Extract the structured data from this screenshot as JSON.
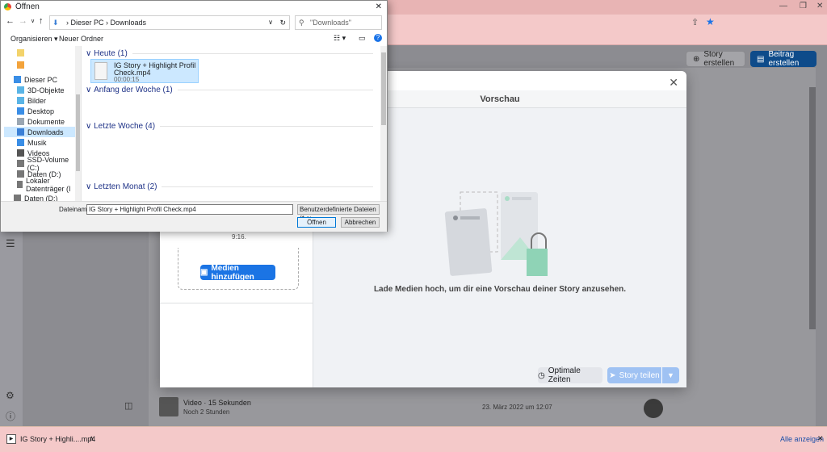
{
  "browser": {
    "bookmark_hint": ""
  },
  "page": {
    "story_button": "Story erstellen",
    "post_button": "Beitrag erstellen",
    "row_title": "Video · 15 Sekunden",
    "row_sub": "Noch 2 Stunden",
    "row_date": "23. März 2022 um 12:07"
  },
  "modal": {
    "preview_title": "Vorschau",
    "ratio_text": "9:16.",
    "add_media": "Medien hinzufügen",
    "empty_text": "Lade Medien hoch, um dir eine Vorschau deiner Story anzusehen.",
    "optimal_times": "Optimale Zeiten",
    "share_story": "Story teilen"
  },
  "dialog": {
    "title": "Öffnen",
    "path_pc": "Dieser PC",
    "path_folder": "Downloads",
    "search_placeholder": "\"Downloads\" durchsuchen",
    "organize": "Organisieren ▾",
    "new_folder": "Neuer Ordner",
    "tree": [
      {
        "label": "",
        "color": "#f3d36b"
      },
      {
        "label": "",
        "color": "#f3a33b"
      },
      {
        "label": "Dieser PC",
        "color": "#3a8ee6"
      },
      {
        "label": "3D-Objekte",
        "color": "#5ab4e6"
      },
      {
        "label": "Bilder",
        "color": "#5ab4e6"
      },
      {
        "label": "Desktop",
        "color": "#3a8ee6"
      },
      {
        "label": "Dokumente",
        "color": "#9aa6b2"
      },
      {
        "label": "Downloads",
        "color": "#3a7fd6"
      },
      {
        "label": "Musik",
        "color": "#3a8ee6"
      },
      {
        "label": "Videos",
        "color": "#555"
      },
      {
        "label": "SSD-Volume (C:)",
        "color": "#777"
      },
      {
        "label": "Daten (D:)",
        "color": "#777"
      },
      {
        "label": "Lokaler Datenträger (I",
        "color": "#777"
      },
      {
        "label": "Daten (D:)",
        "color": "#777"
      }
    ],
    "groups": {
      "today": "Heute (1)",
      "week": "Anfang der Woche (1)",
      "last_week": "Letzte Woche (4)",
      "last_month": "Letzten Monat (2)"
    },
    "file": {
      "name_line1": "IG Story + Highlight Profil",
      "name_line2": "Check.mp4",
      "duration": "00:00:15"
    },
    "filename_label": "Dateiname:",
    "filename_value": "IG Story + Highlight Profil Check.mp4",
    "filetype": "Benutzerdefinierte Dateien (*.o;",
    "open": "Öffnen",
    "cancel": "Abbrechen"
  },
  "downloads": {
    "item": "IG Story + Highli....mp4",
    "show_all": "Alle anzeigen"
  },
  "colors": {
    "primary_blue": "#1b74e4",
    "dark_blue": "#0e4b8a",
    "chrome_pink": "#f4c9c9"
  }
}
